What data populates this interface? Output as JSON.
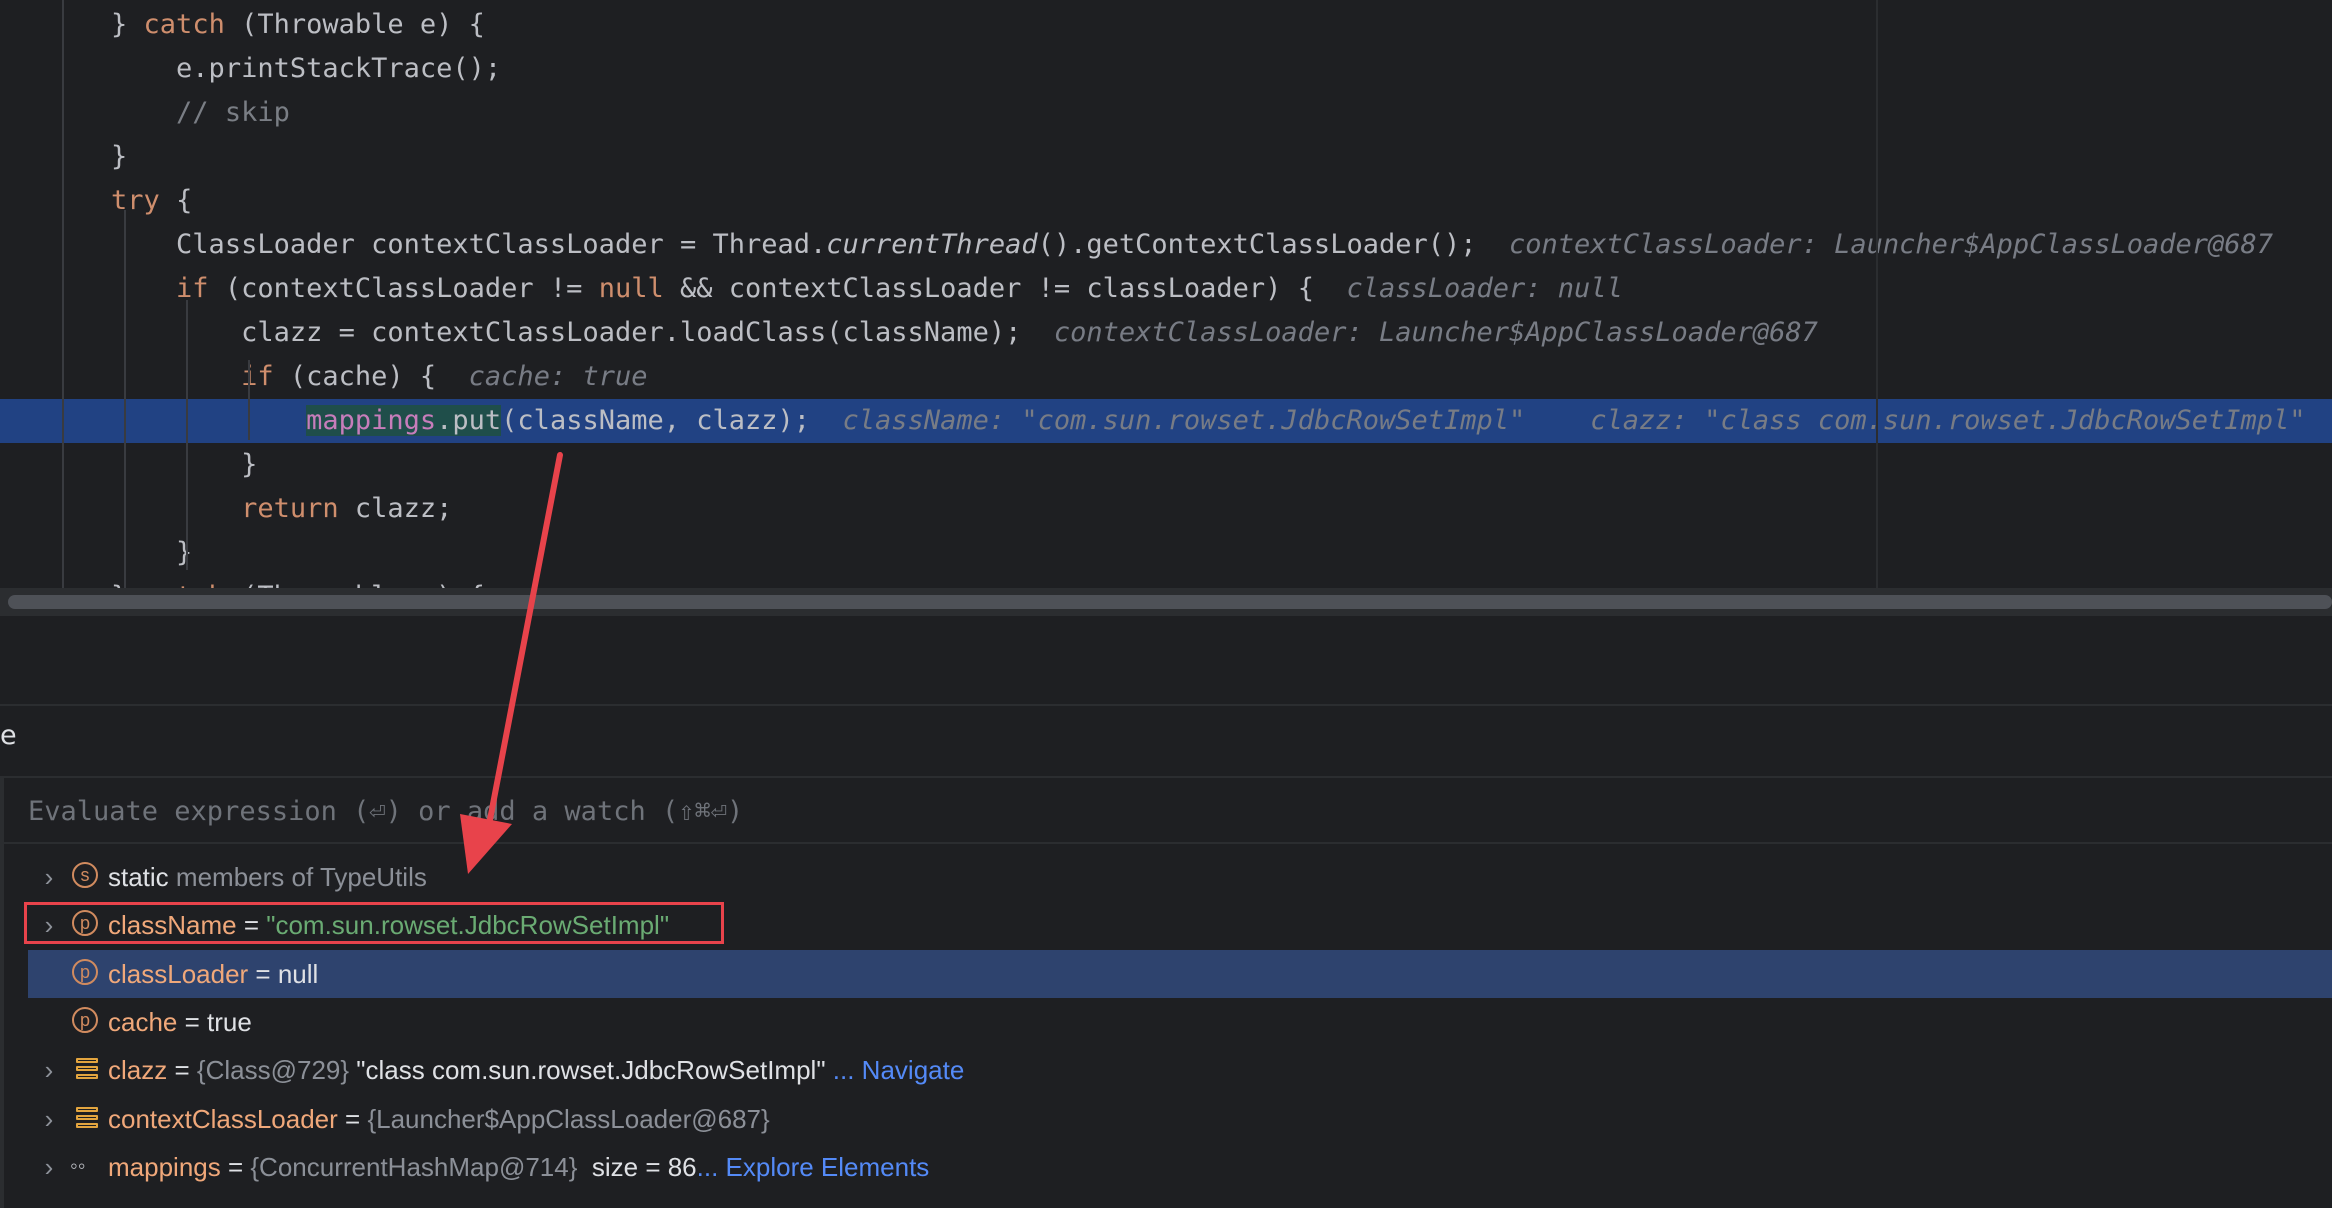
{
  "editor": {
    "lines": [
      {
        "indent": "    ",
        "parts": [
          [
            "",
            "} "
          ],
          [
            "kw",
            "catch"
          ],
          [
            "",
            " (Throwable e) {"
          ]
        ]
      },
      {
        "indent": "        ",
        "parts": [
          [
            "",
            "e.printStackTrace();"
          ]
        ]
      },
      {
        "indent": "        ",
        "parts": [
          [
            "cm",
            "// skip"
          ]
        ]
      },
      {
        "indent": "    ",
        "parts": [
          [
            "",
            "}"
          ]
        ]
      },
      {
        "indent": "    ",
        "parts": [
          [
            "kw",
            "try"
          ],
          [
            "",
            " {"
          ]
        ]
      },
      {
        "indent": "        ",
        "parts": [
          [
            "",
            "ClassLoader contextClassLoader = Thread."
          ],
          [
            "it",
            "currentThread"
          ],
          [
            "",
            "().getContextClassLoader();"
          ]
        ],
        "inlay": "contextClassLoader: Launcher$AppClassLoader@687"
      },
      {
        "indent": "        ",
        "parts": [
          [
            "kw",
            "if"
          ],
          [
            "",
            " (contextClassLoader != "
          ],
          [
            "kw",
            "null"
          ],
          [
            "",
            " && contextClassLoader != classLoader) {"
          ]
        ],
        "inlay": "classLoader: null"
      },
      {
        "indent": "            ",
        "parts": [
          [
            "",
            "clazz = contextClassLoader.loadClass(className);"
          ]
        ],
        "inlay": "contextClassLoader: Launcher$AppClassLoader@687"
      },
      {
        "indent": "            ",
        "parts": [
          [
            "kw",
            "if"
          ],
          [
            "",
            " (cache) {"
          ]
        ],
        "inlay": "cache: true"
      },
      {
        "indent": "                ",
        "parts": [
          [
            "fld put-bg",
            "mappings"
          ],
          [
            "put-bg",
            ".put"
          ],
          [
            "",
            "(className, clazz);"
          ]
        ],
        "inlay": "className: \"com.sun.rowset.JdbcRowSetImpl\"    clazz: \"class com.sun.rowset.JdbcRowSetImpl\"",
        "highlight": true
      },
      {
        "indent": "            ",
        "parts": [
          [
            "",
            "}"
          ]
        ]
      },
      {
        "indent": "            ",
        "parts": [
          [
            "kw",
            "return"
          ],
          [
            "",
            " clazz;"
          ]
        ]
      },
      {
        "indent": "        ",
        "parts": [
          [
            "",
            "}"
          ]
        ]
      },
      {
        "indent": "    ",
        "parts": [
          [
            "",
            "} "
          ],
          [
            "kw",
            "catch"
          ],
          [
            "",
            " (Throwable e) {"
          ]
        ]
      }
    ]
  },
  "panel": {
    "title_fragment": "e",
    "eval_placeholder": "Evaluate expression (⏎) or add a watch (⇧⌘⏎)"
  },
  "variables": [
    {
      "chevron": "›",
      "icon": "s",
      "parts": [
        [
          "",
          "static "
        ],
        [
          "dim",
          "members of TypeUtils"
        ]
      ]
    },
    {
      "chevron": "›",
      "icon": "p",
      "parts": [
        [
          "vname",
          "className"
        ],
        [
          "",
          " = "
        ],
        [
          "str",
          "\"com.sun.rowset.JdbcRowSetImpl\""
        ]
      ]
    },
    {
      "chevron": "",
      "icon": "p",
      "parts": [
        [
          "vname",
          "classLoader"
        ],
        [
          "",
          " = null"
        ]
      ],
      "selected": true
    },
    {
      "chevron": "",
      "icon": "p",
      "parts": [
        [
          "vname",
          "cache"
        ],
        [
          "",
          " = true"
        ]
      ]
    },
    {
      "chevron": "›",
      "icon": "field",
      "parts": [
        [
          "vname",
          "clazz"
        ],
        [
          "",
          " = "
        ],
        [
          "dim",
          "{Class@729}"
        ],
        [
          "",
          " \"class com.sun.rowset.JdbcRowSetImpl\" "
        ],
        [
          "link",
          "... Navigate"
        ]
      ]
    },
    {
      "chevron": "›",
      "icon": "field",
      "parts": [
        [
          "vname",
          "contextClassLoader"
        ],
        [
          "",
          " = "
        ],
        [
          "dim",
          "{Launcher$AppClassLoader@687}"
        ]
      ]
    },
    {
      "chevron": "›",
      "icon": "glasses",
      "parts": [
        [
          "vname",
          "mappings"
        ],
        [
          "",
          " = "
        ],
        [
          "dim",
          "{ConcurrentHashMap@714}"
        ],
        [
          "",
          "  size = 86"
        ],
        [
          "link",
          "... Explore Elements"
        ]
      ]
    }
  ],
  "colors": {
    "accent": "#214283",
    "callout": "#e8434b"
  }
}
